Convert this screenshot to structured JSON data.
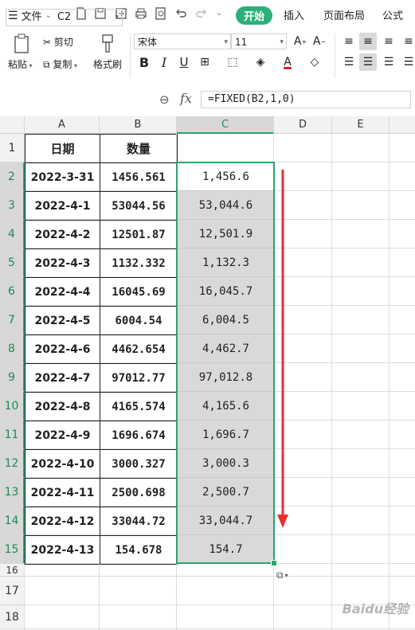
{
  "menubar": {
    "file_label": "文件",
    "tabs": [
      "开始",
      "插入",
      "页面布局",
      "公式"
    ]
  },
  "ribbon": {
    "paste_label": "粘贴",
    "cut_label": "剪切",
    "copy_label": "复制",
    "format_painter_label": "格式刷",
    "font_name": "宋体",
    "font_size": "11",
    "font_color": "#e02020",
    "icons": [
      "increase-font",
      "decrease-font",
      "bold",
      "italic",
      "underline",
      "border",
      "fill-color",
      "font-color",
      "clear",
      "align-top",
      "align-middle",
      "align-bottom",
      "align-left",
      "align-center",
      "align-right"
    ]
  },
  "formula_bar": {
    "cell_ref": "C2",
    "formula": "=FIXED(B2,1,0)"
  },
  "columns": [
    "A",
    "B",
    "C",
    "D",
    "E"
  ],
  "rows": [
    "1",
    "2",
    "3",
    "4",
    "5",
    "6",
    "7",
    "8",
    "9",
    "10",
    "11",
    "12",
    "13",
    "14",
    "15",
    "16",
    "17",
    "18"
  ],
  "table": {
    "headers": [
      "日期",
      "数量"
    ],
    "records": [
      {
        "date": "2022-3-31",
        "qty": "1456.561",
        "fixed": "1,456.6"
      },
      {
        "date": "2022-4-1",
        "qty": "53044.56",
        "fixed": "53,044.6"
      },
      {
        "date": "2022-4-2",
        "qty": "12501.87",
        "fixed": "12,501.9"
      },
      {
        "date": "2022-4-3",
        "qty": "1132.332",
        "fixed": "1,132.3"
      },
      {
        "date": "2022-4-4",
        "qty": "16045.69",
        "fixed": "16,045.7"
      },
      {
        "date": "2022-4-5",
        "qty": "6004.54",
        "fixed": "6,004.5"
      },
      {
        "date": "2022-4-6",
        "qty": "4462.654",
        "fixed": "4,462.7"
      },
      {
        "date": "2022-4-7",
        "qty": "97012.77",
        "fixed": "97,012.8"
      },
      {
        "date": "2022-4-8",
        "qty": "4165.574",
        "fixed": "4,165.6"
      },
      {
        "date": "2022-4-9",
        "qty": "1696.674",
        "fixed": "1,696.7"
      },
      {
        "date": "2022-4-10",
        "qty": "3000.327",
        "fixed": "3,000.3"
      },
      {
        "date": "2022-4-11",
        "qty": "2500.698",
        "fixed": "2,500.7"
      },
      {
        "date": "2022-4-12",
        "qty": "33044.72",
        "fixed": "33,044.7"
      },
      {
        "date": "2022-4-13",
        "qty": "154.678",
        "fixed": "154.7"
      }
    ]
  },
  "colors": {
    "accent": "#2cb07a",
    "selection_border": "#2aa46b",
    "arrow": "#e53030"
  },
  "watermark": "Baidu经验"
}
